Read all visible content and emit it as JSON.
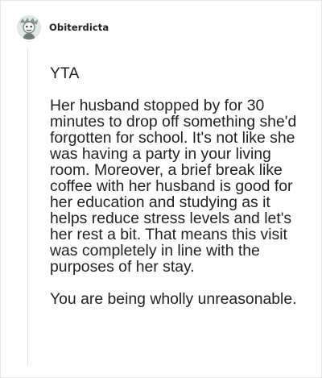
{
  "comment": {
    "author": {
      "username": "Obiterdicta",
      "avatar_icon": "user-avatar-icon"
    },
    "paragraphs": [
      "YTA",
      "Her husband stopped by for 30 minutes to drop off something she'd forgotten for school. It's not like she was having a party in your living room. Moreover, a brief break like coffee with her husband is good for her education and studying as it helps reduce stress levels and let's her rest a bit. That means this visit was completely in line with the purposes of her stay.",
      "You are being wholly unreasonable."
    ]
  },
  "colors": {
    "text": "#222222",
    "divider": "#e3e3e3",
    "avatar_bg": "#dfe6e3",
    "avatar_figure": "#6f7a78"
  }
}
